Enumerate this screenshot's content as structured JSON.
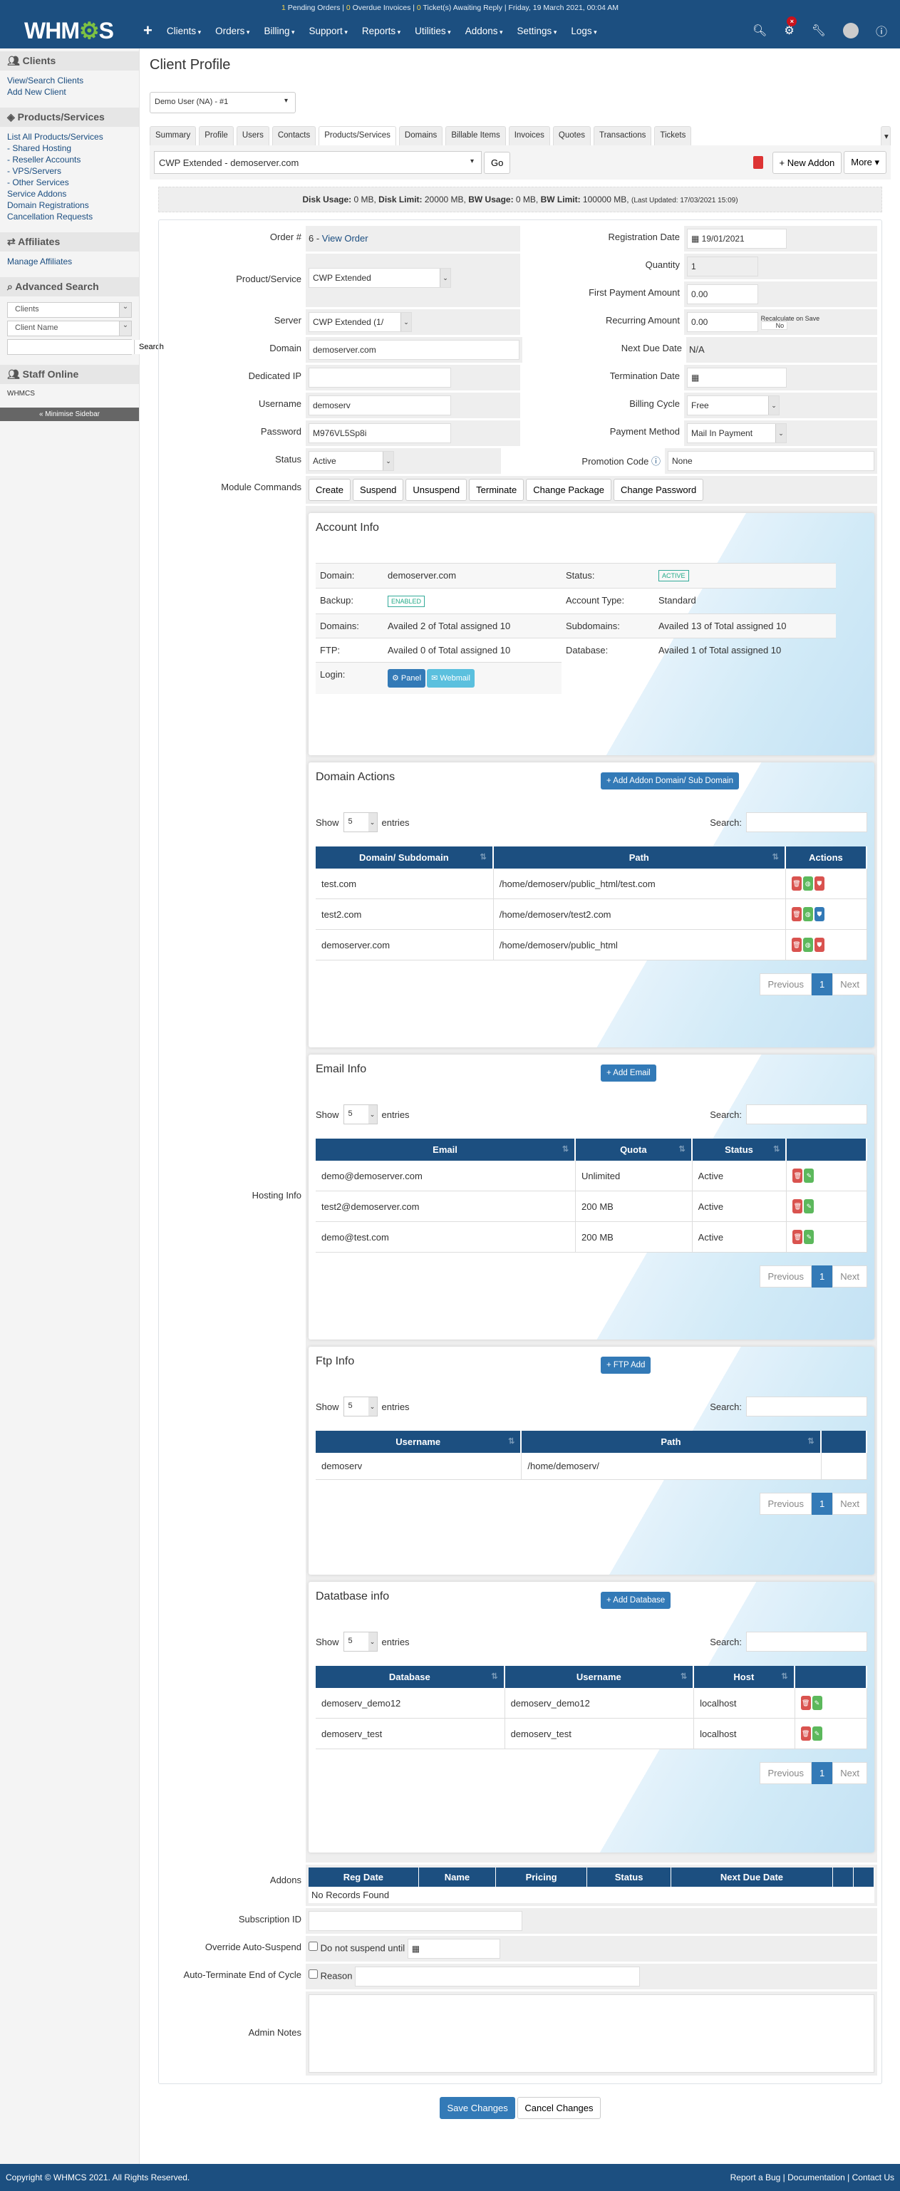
{
  "header": {
    "notice": {
      "pending_count": "1",
      "pending_label": " Pending Orders | ",
      "overdue_count": "0",
      "overdue_label": " Overdue Invoices | ",
      "tickets_count": "0",
      "tickets_label": " Ticket(s) Awaiting Reply | Friday, 19 March 2021, 00:04 AM"
    },
    "logo": "WHMCS",
    "menu": [
      "Clients",
      "Orders",
      "Billing",
      "Support",
      "Reports",
      "Utilities",
      "Addons",
      "Settings",
      "Logs"
    ],
    "icons": [
      "search-icon",
      "gears-icon",
      "wrench-icon",
      "avatar-icon",
      "help-icon"
    ]
  },
  "sidebar": {
    "clients_title": "Clients",
    "clients_links": [
      "View/Search Clients",
      "Add New Client"
    ],
    "products_title": "Products/Services",
    "products_links": [
      "List All Products/Services",
      "- Shared Hosting",
      "- Reseller Accounts",
      "- VPS/Servers",
      "- Other Services",
      "Service Addons",
      "Domain Registrations",
      "Cancellation Requests"
    ],
    "affiliates_title": "Affiliates",
    "affiliates_links": [
      "Manage Affiliates"
    ],
    "advsearch_title": "Advanced Search",
    "adv_type": "Clients",
    "adv_field": "Client Name",
    "adv_button": "Search",
    "staff_title": "Staff Online",
    "staff_name": "WHMCS",
    "minimise": "« Minimise Sidebar"
  },
  "main": {
    "title": "Client Profile",
    "client_select": "Demo User (NA) - #1",
    "tabs": [
      "Summary",
      "Profile",
      "Users",
      "Contacts",
      "Products/Services",
      "Domains",
      "Billable Items",
      "Invoices",
      "Quotes",
      "Transactions",
      "Tickets"
    ],
    "active_tab": "Products/Services",
    "product_select": "CWP Extended - demoserver.com",
    "go": "Go",
    "new_addon": "+ New Addon",
    "more": "More ▾",
    "usage": {
      "disk_usage_l": "Disk Usage:",
      "disk_usage": " 0 MB, ",
      "disk_limit_l": "Disk Limit:",
      "disk_limit": " 20000 MB, ",
      "bw_usage_l": "BW Usage:",
      "bw_usage": " 0 MB, ",
      "bw_limit_l": "BW Limit:",
      "bw_limit": " 100000 MB, ",
      "updated": "(Last Updated: 17/03/2021 15:09)"
    }
  },
  "form": {
    "order_label": "Order #",
    "order_value": "6 - ",
    "order_link": "View Order",
    "product_label": "Product/Service",
    "product_value": "CWP Extended",
    "server_label": "Server",
    "server_value": "CWP Extended (1/",
    "domain_label": "Domain",
    "domain_value": "demoserver.com",
    "ip_label": "Dedicated IP",
    "ip_value": "",
    "username_label": "Username",
    "username_value": "demoserv",
    "password_label": "Password",
    "password_value": "M976VL5Sp8i",
    "status_label": "Status",
    "status_value": "Active",
    "regdate_label": "Registration Date",
    "regdate_value": "19/01/2021",
    "qty_label": "Quantity",
    "qty_value": "1",
    "firstpay_label": "First Payment Amount",
    "firstpay_value": "0.00",
    "recurring_label": "Recurring Amount",
    "recurring_value": "0.00",
    "recalc_label": "Recalculate on Save",
    "recalc_value": "No",
    "nextdue_label": "Next Due Date",
    "nextdue_value": "N/A",
    "termdate_label": "Termination Date",
    "termdate_value": "",
    "billing_label": "Billing Cycle",
    "billing_value": "Free",
    "paymethod_label": "Payment Method",
    "paymethod_value": "Mail In Payment",
    "promo_label": "Promotion Code",
    "promo_value": "None",
    "module_label": "Module Commands",
    "module_commands": [
      "Create",
      "Suspend",
      "Unsuspend",
      "Terminate",
      "Change Package",
      "Change Password"
    ],
    "hosting_label": "Hosting Info"
  },
  "account_info": {
    "title": "Account Info",
    "domain_k": "Domain:",
    "domain_v": "demoserver.com",
    "status_k": "Status:",
    "status_v": "ACTIVE",
    "backup_k": "Backup:",
    "backup_v": "ENABLED",
    "type_k": "Account Type:",
    "type_v": "Standard",
    "domains_k": "Domains:",
    "domains_v": "Availed 2 of Total assigned 10",
    "subdomains_k": "Subdomains:",
    "subdomains_v": "Availed 13 of Total assigned 10",
    "ftp_k": "FTP:",
    "ftp_v": "Availed 0 of Total assigned 10",
    "db_k": "Database:",
    "db_v": "Availed 1 of Total assigned 10",
    "login_k": "Login:",
    "panel": "Panel",
    "webmail": "Webmail"
  },
  "tables_common": {
    "show": "Show",
    "entries": "entries",
    "page_size": "5",
    "search": "Search:",
    "previous": "Previous",
    "page": "1",
    "next": "Next"
  },
  "domain_actions": {
    "title": "Domain Actions",
    "add": "+ Add Addon Domain/ Sub Domain",
    "headers": [
      "Domain/ Subdomain",
      "Path",
      "Actions"
    ],
    "rows": [
      [
        "test.com",
        "/home/demoserv/public_html/test.com"
      ],
      [
        "test2.com",
        "/home/demoserv/test2.com"
      ],
      [
        "demoserver.com",
        "/home/demoserv/public_html"
      ]
    ]
  },
  "email_info": {
    "title": "Email Info",
    "add": "+ Add Email",
    "headers": [
      "Email",
      "Quota",
      "Status",
      ""
    ],
    "rows": [
      [
        "demo@demoserver.com",
        "Unlimited",
        "Active"
      ],
      [
        "test2@demoserver.com",
        "200 MB",
        "Active"
      ],
      [
        "demo@test.com",
        "200 MB",
        "Active"
      ]
    ]
  },
  "ftp_info": {
    "title": "Ftp Info",
    "add": "+ FTP Add",
    "headers": [
      "Username",
      "Path",
      ""
    ],
    "rows": [
      [
        "demoserv",
        "/home/demoserv/"
      ]
    ]
  },
  "db_info": {
    "title": "Datatbase info",
    "add": "+ Add Database",
    "headers": [
      "Database",
      "Username",
      "Host",
      ""
    ],
    "rows": [
      [
        "demoserv_demo12",
        "demoserv_demo12",
        "localhost"
      ],
      [
        "demoserv_test",
        "demoserv_test",
        "localhost"
      ]
    ]
  },
  "addons": {
    "label": "Addons",
    "headers": [
      "Reg Date",
      "Name",
      "Pricing",
      "Status",
      "Next Due Date"
    ],
    "empty": "No Records Found"
  },
  "extra": {
    "subscription_label": "Subscription ID",
    "override_label": "Override Auto-Suspend",
    "override_text": "Do not suspend until",
    "autoterm_label": "Auto-Terminate End of Cycle",
    "reason": "Reason",
    "notes_label": "Admin Notes"
  },
  "actions": {
    "save": "Save Changes",
    "cancel": "Cancel Changes"
  },
  "footer": {
    "copyright": "Copyright © WHMCS 2021. All Rights Reserved.",
    "links": "Report a Bug | Documentation | Contact Us"
  }
}
